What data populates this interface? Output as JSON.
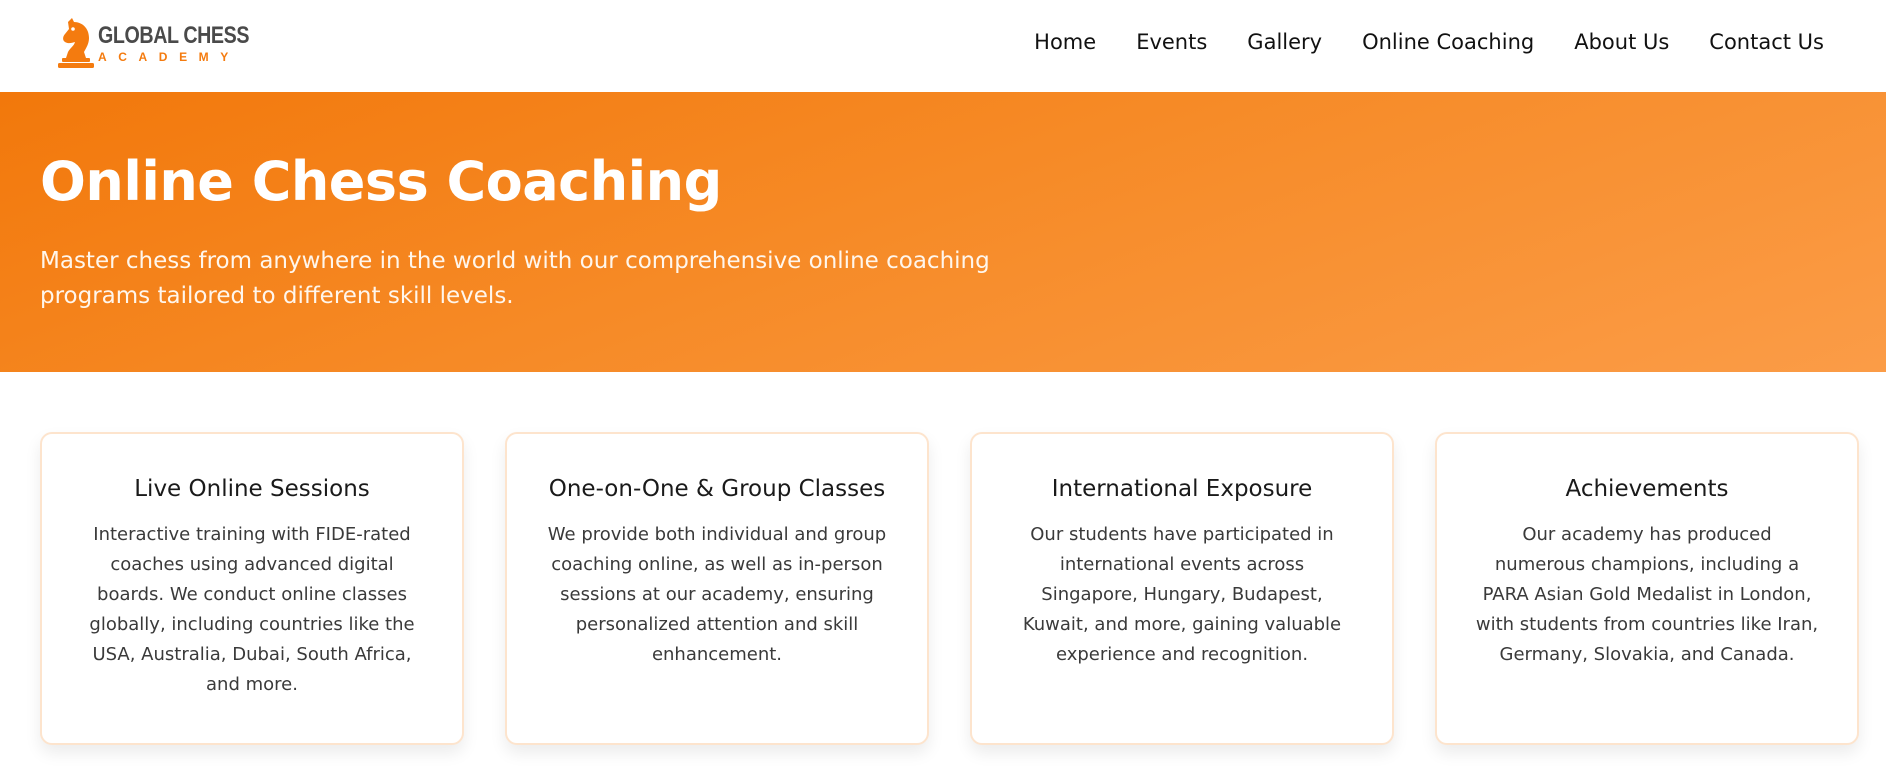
{
  "brand": {
    "name_line1": "GLOBAL CHESS",
    "name_line2": "ACADEMY",
    "primary_color": "#f47b0f",
    "text_color": "#4a4a4a"
  },
  "nav": {
    "items": [
      {
        "label": "Home"
      },
      {
        "label": "Events"
      },
      {
        "label": "Gallery"
      },
      {
        "label": "Online Coaching"
      },
      {
        "label": "About Us"
      },
      {
        "label": "Contact Us"
      }
    ]
  },
  "hero": {
    "title": "Online Chess Coaching",
    "subtitle": "Master chess from anywhere in the world with our comprehensive online coaching programs tailored to different skill levels.",
    "gradient_start": "#f2780b",
    "gradient_end": "#fb9c47"
  },
  "cards": [
    {
      "title": "Live Online Sessions",
      "text": "Interactive training with FIDE-rated coaches using advanced digital boards. We conduct online classes globally, including countries like the USA, Australia, Dubai, South Africa, and more."
    },
    {
      "title": "One-on-One & Group Classes",
      "text": "We provide both individual and group coaching online, as well as in-person sessions at our academy, ensuring personalized attention and skill enhancement."
    },
    {
      "title": "International Exposure",
      "text": "Our students have participated in international events across Singapore, Hungary, Budapest, Kuwait, and more, gaining valuable experience and recognition."
    },
    {
      "title": "Achievements",
      "text": "Our academy has produced numerous champions, including a PARA Asian Gold Medalist in London, with students from countries like Iran, Germany, Slovakia, and Canada."
    }
  ]
}
